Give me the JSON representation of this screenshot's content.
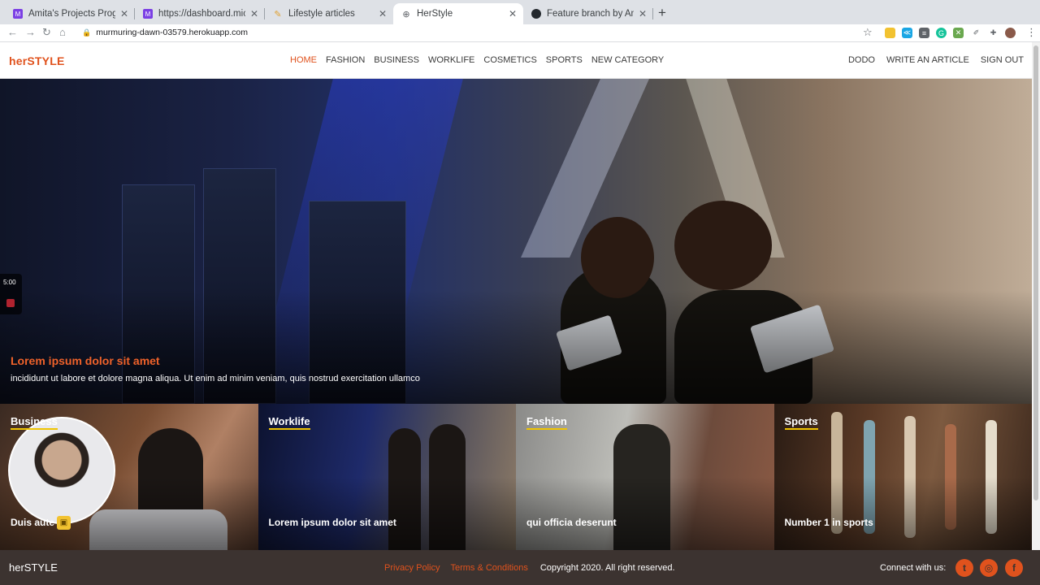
{
  "browser": {
    "tabs": [
      {
        "title": "Amita's Projects Progress",
        "color": "#7b3fe4",
        "active": false
      },
      {
        "title": "https://dashboard.microverse.",
        "color": "#7b3fe4",
        "active": false
      },
      {
        "title": "Lifestyle articles",
        "color": "#e0a030",
        "active": false
      },
      {
        "title": "HerStyle",
        "color": "#5f6368",
        "active": true
      },
      {
        "title": "Feature branch by Amita-Roy",
        "color": "#24292e",
        "active": false
      }
    ],
    "url": "murmuring-dawn-03579.herokuapp.com"
  },
  "header": {
    "logo": "herSTYLE",
    "nav": [
      "HOME",
      "FASHION",
      "BUSINESS",
      "WORKLIFE",
      "COSMETICS",
      "SPORTS",
      "NEW CATEGORY"
    ],
    "active_nav": "HOME",
    "user_links": [
      "DODO",
      "WRITE AN ARTICLE",
      "SIGN OUT"
    ]
  },
  "hero": {
    "title": "Lorem ipsum dolor sit amet",
    "subtitle": "incididunt ut labore et dolore magna aliqua. Ut enim ad minim veniam, quis nostrud exercitation ullamco"
  },
  "recorder": {
    "time": "5:00"
  },
  "cards": [
    {
      "category": "Business",
      "caption": "Duis aute"
    },
    {
      "category": "Worklife",
      "caption": "Lorem ipsum dolor sit amet"
    },
    {
      "category": "Fashion",
      "caption": "qui officia deserunt"
    },
    {
      "category": "Sports",
      "caption": "Number 1 in sports"
    }
  ],
  "footer": {
    "logo": "herSTYLE",
    "privacy": "Privacy Policy",
    "terms": "Terms & Conditions",
    "copyright": "Copyright 2020. All right reserved.",
    "connect": "Connect with us:",
    "social": [
      {
        "name": "twitter-icon",
        "glyph": "t"
      },
      {
        "name": "instagram-icon",
        "glyph": "◎"
      },
      {
        "name": "facebook-icon",
        "glyph": "f"
      }
    ]
  },
  "colors": {
    "accent": "#e0521d",
    "footer_bg": "#3c3330",
    "underline": "#f0c400"
  }
}
